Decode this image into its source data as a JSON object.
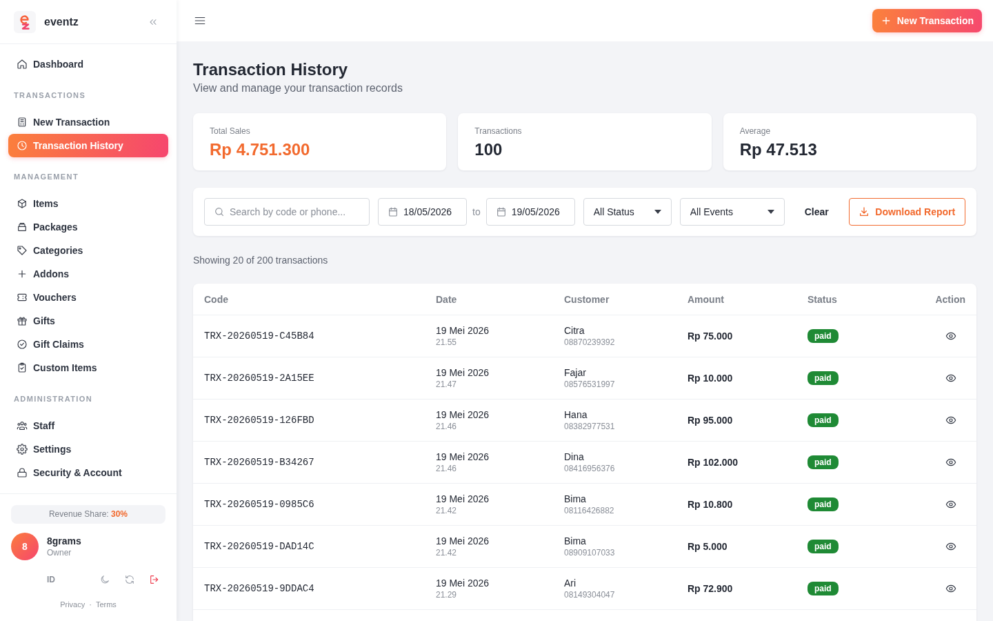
{
  "sidebar": {
    "brand": "eventz",
    "sections": [
      {
        "items": [
          {
            "label": "Dashboard",
            "selected": false
          }
        ]
      },
      {
        "title": "TRANSACTIONS",
        "items": [
          {
            "label": "New Transaction",
            "selected": false
          },
          {
            "label": "Transaction History",
            "selected": true
          }
        ]
      },
      {
        "title": "MANAGEMENT",
        "items": [
          {
            "label": "Items",
            "selected": false
          },
          {
            "label": "Packages",
            "selected": false
          },
          {
            "label": "Categories",
            "selected": false
          },
          {
            "label": "Addons",
            "selected": false
          },
          {
            "label": "Vouchers",
            "selected": false
          },
          {
            "label": "Gifts",
            "selected": false
          },
          {
            "label": "Gift Claims",
            "selected": false
          },
          {
            "label": "Custom Items",
            "selected": false
          }
        ]
      },
      {
        "title": "ADMINISTRATION",
        "items": [
          {
            "label": "Staff",
            "selected": false
          },
          {
            "label": "Settings",
            "selected": false
          },
          {
            "label": "Security & Account",
            "selected": false
          }
        ]
      }
    ],
    "revenue_share": "Revenue Share: **30%**",
    "user": {
      "initial": "8",
      "name": "8grams",
      "role": "Owner"
    },
    "language": "ID",
    "links": [
      "Privacy",
      "Terms"
    ],
    "link_separator": "·"
  },
  "topbar": {
    "action": "New Transaction"
  },
  "page": {
    "title": "Transaction History",
    "subtitle": "View and manage your transaction records"
  },
  "stats": [
    {
      "label": "Total Sales",
      "value": "Rp 4.751.300",
      "highlight": true
    },
    {
      "label": "Transactions",
      "value": "100",
      "highlight": false
    },
    {
      "label": "Average",
      "value": "Rp 47.513",
      "highlight": false
    }
  ],
  "filters": {
    "search": {
      "placeholder": "Search by code or phone..."
    },
    "date_from": "18/05/2026",
    "range_separator": "to",
    "date_to": "19/05/2026",
    "status": "All Status",
    "event": "All Events",
    "clear": "Clear",
    "download": "Download Report"
  },
  "summary": "Showing 20 of 200 transactions",
  "table": {
    "columns": [
      "Code",
      "Date",
      "Customer",
      "Amount",
      "Status",
      "Action"
    ],
    "rows": [
      {
        "code": "TRX-20260519-C45B84",
        "date": "19 Mei 2026",
        "time": "21.55",
        "customer": "Citra",
        "phone": "08870239392",
        "amount": "Rp 75.000",
        "status": "paid"
      },
      {
        "code": "TRX-20260519-2A15EE",
        "date": "19 Mei 2026",
        "time": "21.47",
        "customer": "Fajar",
        "phone": "08576531997",
        "amount": "Rp 10.000",
        "status": "paid"
      },
      {
        "code": "TRX-20260519-126FBD",
        "date": "19 Mei 2026",
        "time": "21.46",
        "customer": "Hana",
        "phone": "08382977531",
        "amount": "Rp 95.000",
        "status": "paid"
      },
      {
        "code": "TRX-20260519-B34267",
        "date": "19 Mei 2026",
        "time": "21.46",
        "customer": "Dina",
        "phone": "08416956376",
        "amount": "Rp 102.000",
        "status": "paid"
      },
      {
        "code": "TRX-20260519-0985C6",
        "date": "19 Mei 2026",
        "time": "21.42",
        "customer": "Bima",
        "phone": "08116426882",
        "amount": "Rp 10.800",
        "status": "paid"
      },
      {
        "code": "TRX-20260519-DAD14C",
        "date": "19 Mei 2026",
        "time": "21.42",
        "customer": "Bima",
        "phone": "08909107033",
        "amount": "Rp 5.000",
        "status": "paid"
      },
      {
        "code": "TRX-20260519-9DDAC4",
        "date": "19 Mei 2026",
        "time": "21.29",
        "customer": "Ari",
        "phone": "08149304047",
        "amount": "Rp 72.900",
        "status": "paid"
      }
    ]
  }
}
